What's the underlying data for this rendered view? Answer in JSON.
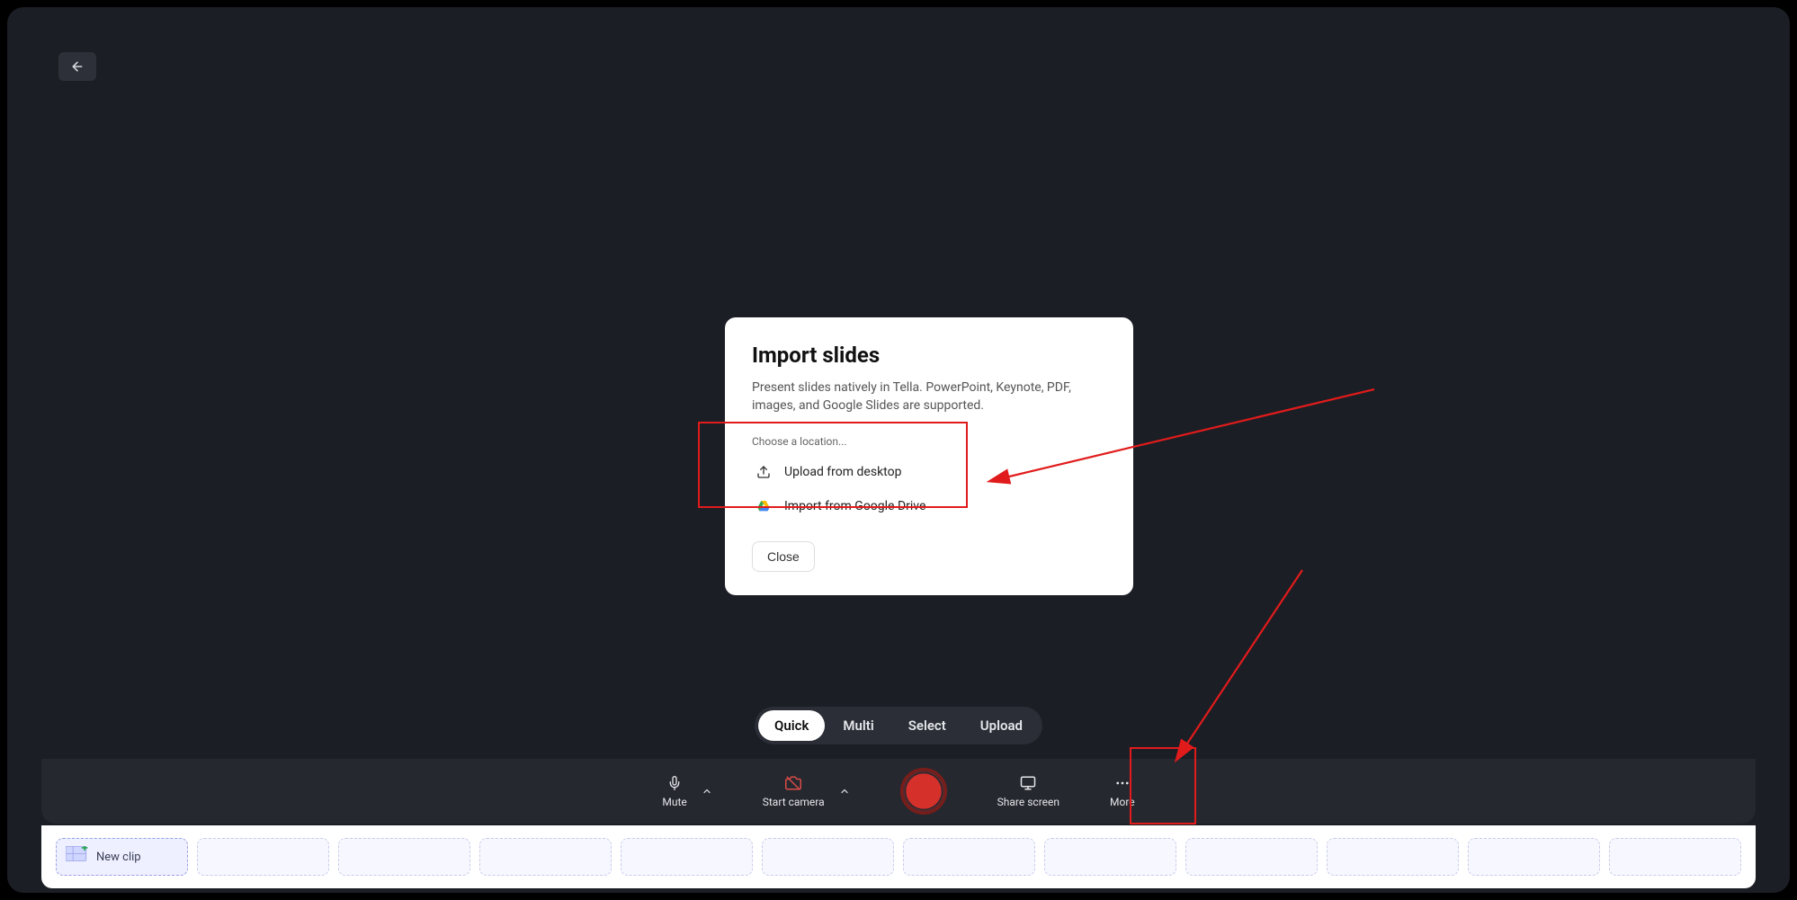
{
  "dialog": {
    "title": "Import slides",
    "description": "Present slides natively in Tella. PowerPoint, Keynote, PDF, images, and Google Slides are supported.",
    "section_label": "Choose a location...",
    "upload_label": "Upload from desktop",
    "gdrive_label": "Import from Google Drive",
    "close_label": "Close"
  },
  "modes": {
    "quick": "Quick",
    "multi": "Multi",
    "select": "Select",
    "upload": "Upload"
  },
  "toolbar": {
    "mute": "Mute",
    "start_camera": "Start camera",
    "share_screen": "Share screen",
    "more": "More"
  },
  "timeline": {
    "new_clip": "New clip"
  }
}
